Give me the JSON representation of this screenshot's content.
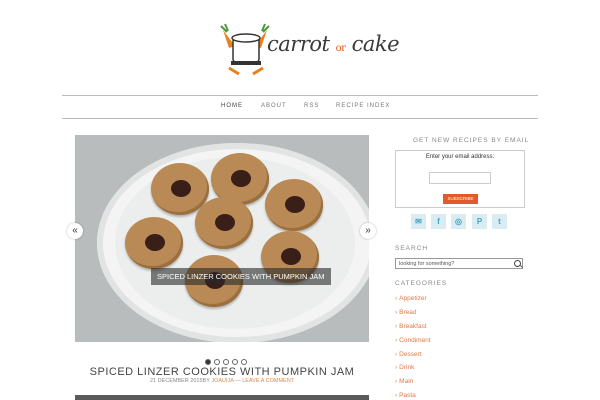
{
  "logo": {
    "text_main": "carrot",
    "text_or": "or",
    "text_end": "cake"
  },
  "nav": {
    "items": [
      "HOME",
      "ABOUT",
      "RSS",
      "RECIPE INDEX"
    ]
  },
  "slider": {
    "caption": "SPICED LINZER COOKIES WITH PUMPKIN JAM",
    "prev": "«",
    "next": "»",
    "dot_count": 5,
    "active_dot": 1
  },
  "post": {
    "title": "SPICED LINZER COOKIES WITH PUMPKIN JAM",
    "date": "21 DECEMBER 2015",
    "by": "BY",
    "author": "JOAUIJA",
    "sep": " — ",
    "comment": "LEAVE A COMMENT"
  },
  "sidebar": {
    "email_title": "GET NEW RECIPES BY EMAIL",
    "email_label": "Enter your email address:",
    "subscribe": "SUBSCRIBE",
    "social": [
      {
        "icon": "mail-icon",
        "glyph": "✉"
      },
      {
        "icon": "facebook-icon",
        "glyph": "f"
      },
      {
        "icon": "instagram-icon",
        "glyph": "◎"
      },
      {
        "icon": "pinterest-icon",
        "glyph": "P"
      },
      {
        "icon": "twitter-icon",
        "glyph": "t"
      }
    ],
    "search_title": "SEARCH",
    "search_placeholder": "looking for something?",
    "categories_title": "CATEGORIES",
    "categories": [
      "Appetizer",
      "Bread",
      "Breakfast",
      "Condiment",
      "Dessert",
      "Drink",
      "Main",
      "Pasta"
    ]
  },
  "colors": {
    "accent": "#e0784a",
    "subscribe": "#e05a2c",
    "social_bg": "#d8ecf2",
    "social_fg": "#42a5c3"
  }
}
